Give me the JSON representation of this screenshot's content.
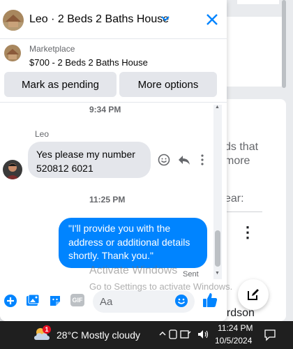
{
  "chat": {
    "header_title": "Leo · 2 Beds 2 Baths House",
    "marketplace_label": "Marketplace",
    "listing_title": "$700 - 2 Beds 2 Baths House",
    "buttons": {
      "pending": "Mark as pending",
      "more": "More options"
    },
    "messages": {
      "time1": "9:34 PM",
      "sender": "Leo",
      "incoming_line1": "Yes please my number",
      "incoming_line2": "520812 6021",
      "time2": "11:25 PM",
      "outgoing_line1": "\"I'll provide you with the",
      "outgoing_line2": "address or additional details",
      "outgoing_line3": "shortly. Thank you.\"",
      "status": "Sent"
    },
    "composer": {
      "placeholder": "Aa",
      "gif_label": "GIF"
    }
  },
  "watermark": {
    "line1": "Activate Windows",
    "line2": "Go to Settings to activate Windows."
  },
  "background": {
    "text1": "ds that",
    "text2": "more",
    "text3": "ear:",
    "text4": "ardson"
  },
  "taskbar": {
    "badge": "1",
    "weather": "28°C  Mostly cloudy",
    "time": "11:24 PM",
    "date": "10/5/2024"
  },
  "colors": {
    "accent": "#0084ff",
    "bubble_in": "#e4e6eb",
    "taskbar": "#1f1f1f"
  }
}
